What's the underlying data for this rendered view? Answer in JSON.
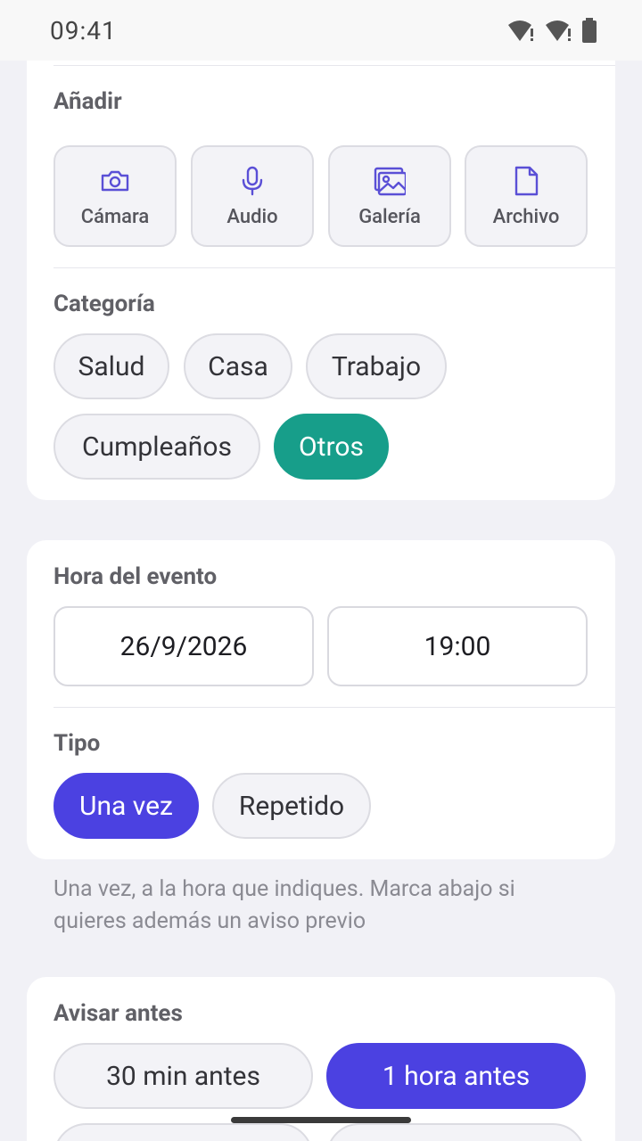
{
  "status": {
    "time": "09:41"
  },
  "add": {
    "title": "Añadir",
    "buttons": [
      {
        "label": "Cámara",
        "icon": "camera-icon"
      },
      {
        "label": "Audio",
        "icon": "microphone-icon"
      },
      {
        "label": "Galería",
        "icon": "gallery-icon"
      },
      {
        "label": "Archivo",
        "icon": "file-icon"
      }
    ]
  },
  "category": {
    "title": "Categoría",
    "chips": [
      "Salud",
      "Casa",
      "Trabajo",
      "Cumpleaños",
      "Otros"
    ],
    "selected": "Otros"
  },
  "event_time": {
    "title": "Hora del evento",
    "date": "26/9/2026",
    "time": "19:00"
  },
  "type": {
    "title": "Tipo",
    "options": [
      "Una vez",
      "Repetido"
    ],
    "selected": "Una vez",
    "helper": "Una vez, a la hora que indiques. Marca abajo si quieres además un aviso previo"
  },
  "notify_before": {
    "title": "Avisar antes",
    "options": [
      "30 min antes",
      "1 hora antes"
    ],
    "selected": "1 hora antes"
  },
  "colors": {
    "accent": "#4b41e1",
    "teal": "#179e8a",
    "icon": "#5a4fd6"
  }
}
